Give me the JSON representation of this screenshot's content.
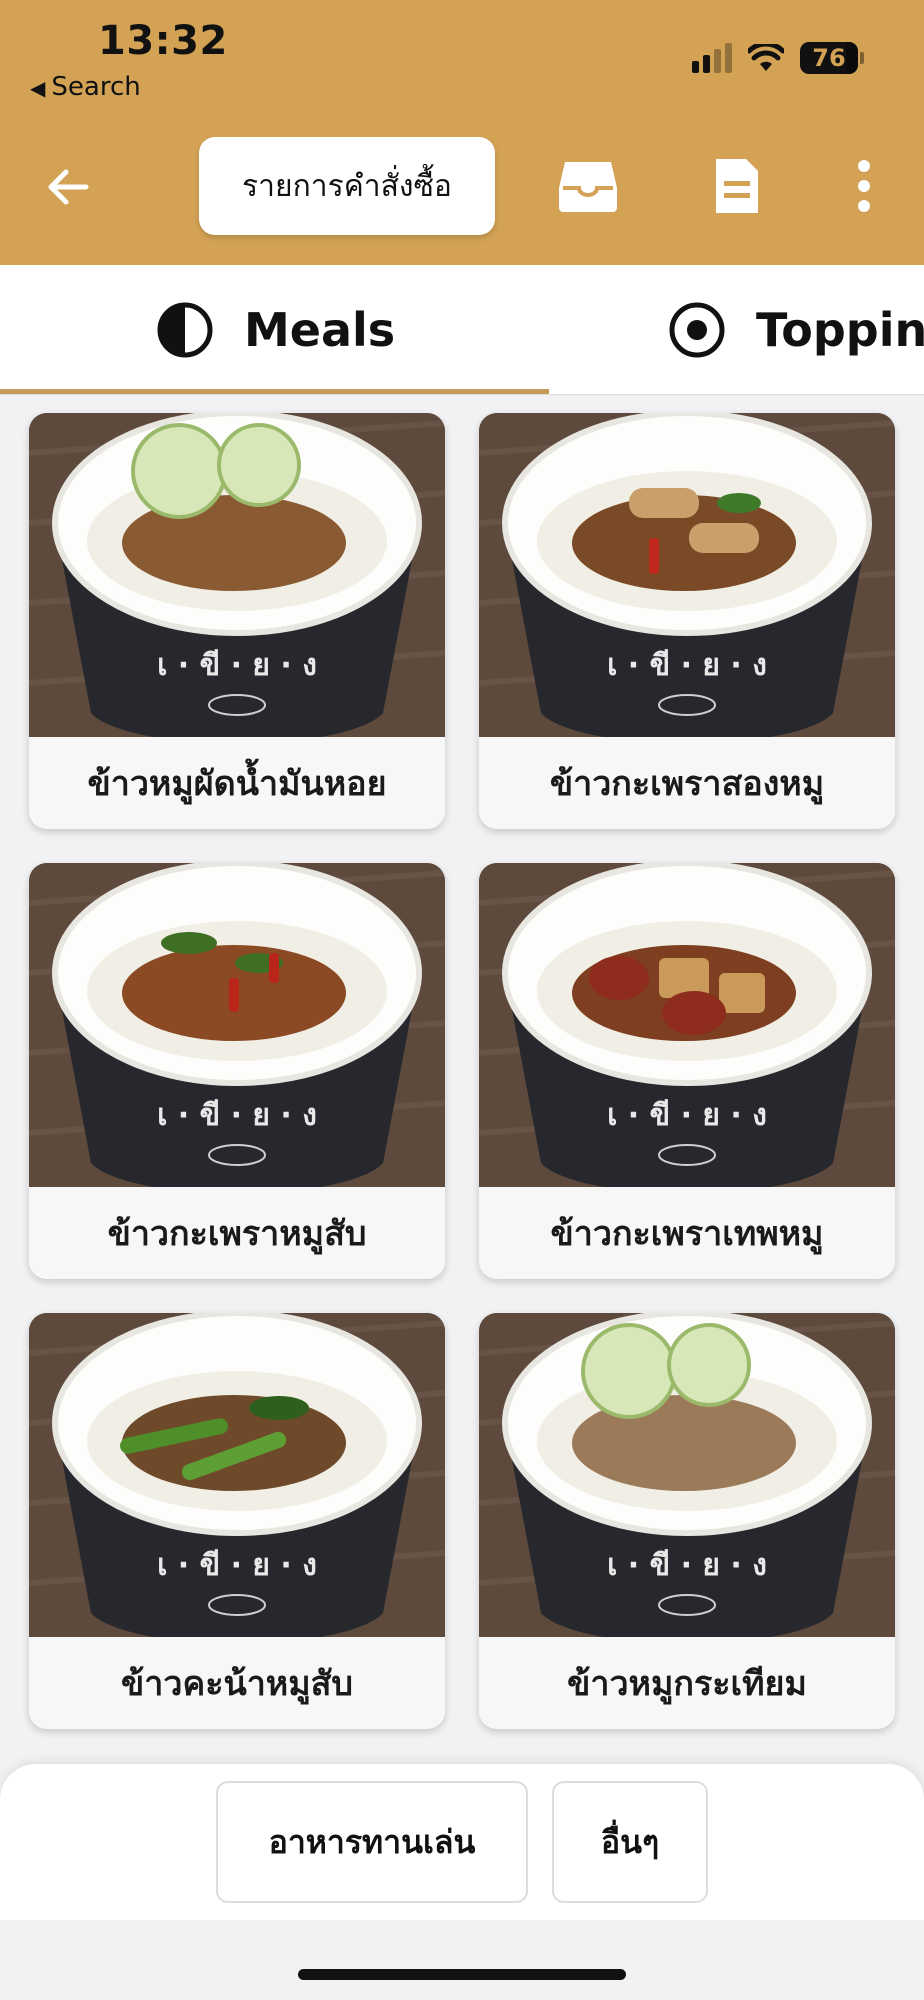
{
  "status_bar": {
    "time": "13:32",
    "back_app": "Search",
    "battery": "76"
  },
  "header": {
    "order_list_label": "รายการคำสั่งซื้อ",
    "icons": [
      "arrow-left-icon",
      "inbox-tray-icon",
      "receipt-icon",
      "more-vertical-icon"
    ]
  },
  "tabs": [
    {
      "label": "Meals",
      "icon": "half-circle-icon",
      "selected": true
    },
    {
      "label": "Toppings",
      "icon": "radio-dot-icon",
      "selected": false
    }
  ],
  "menu_items": [
    {
      "name": "ข้าวหมูผัดน้ำมันหอย"
    },
    {
      "name": "ข้าวกะเพราสองหมู"
    },
    {
      "name": "ข้าวกะเพราหมูสับ"
    },
    {
      "name": "ข้าวกะเพราเทพหมู"
    },
    {
      "name": "ข้าวคะน้าหมูสับ"
    },
    {
      "name": "ข้าวหมูกระเทียม"
    }
  ],
  "bowl_label": "เ · ขี · ย · ง",
  "bottom_categories": [
    {
      "label": "อาหารทานเล่น"
    },
    {
      "label": "อื่นๆ"
    }
  ],
  "colors": {
    "header": "#d3a255",
    "tab_underline": "#c69a58"
  }
}
